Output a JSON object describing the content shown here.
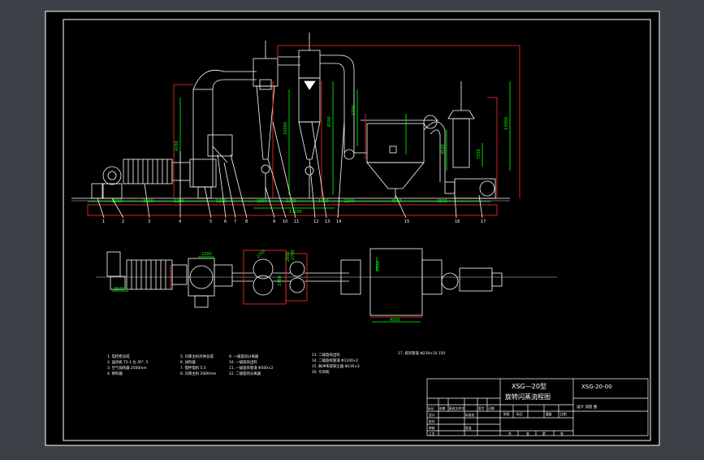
{
  "colors": {
    "outer_bg": "#3c4047",
    "sheet": "#000000",
    "line": "#ffffff",
    "dim": "#00ff00",
    "pipe": "#ff3030",
    "accent": "#ffff00",
    "cyan": "#00d8ff"
  },
  "title_block": {
    "drawing_no": "XSG-20-00",
    "title_line1": "XSG—20型",
    "title_line2": "旋转闪蒸流程图",
    "design_row": "设计  流程  图",
    "row_labels": [
      "标记",
      "处数",
      "更改文件号",
      "签字",
      "日期"
    ],
    "left_labels": [
      "设计",
      "校对",
      "审核",
      "工艺"
    ],
    "mid_labels": [
      "标准化",
      "批准"
    ],
    "stage_labels": [
      "阶段",
      "标记",
      "重量",
      "比例"
    ],
    "bottom_labels": [
      "共",
      "张",
      "第",
      "张"
    ]
  },
  "parts_list": {
    "col1": [
      "1.  电控柜总成",
      "2.  送风机 T2-1 左  45°, 5",
      "3.  空气加热器  2500mm",
      "4.  供料器"
    ],
    "col2": [
      "5.  闪蒸主机壳体总成",
      "6.  加料器",
      "7.  搅拌电机 5.5",
      "8.  闪蒸主机 2000mm"
    ],
    "col3": [
      "9.  一级旋风分离器",
      "10.  一级旋风出料",
      "11.  一级旋风管道 Φ500×2",
      "12.  二级旋风分离器"
    ],
    "col4": [
      "13.  二级旋风出料",
      "14.  二级旋风管道 Φ1100×2",
      "15.  脉冲布袋除尘器 Φ216×2",
      "16.  引风机"
    ],
    "col5": [
      "17.  排风管道 Φ219×10  150"
    ]
  },
  "elevation": {
    "dims": [
      "2500",
      "3300",
      "1200",
      "1200",
      "1800",
      "1200",
      "1400",
      "2200",
      "4500",
      "3200"
    ],
    "total_dim": "13200",
    "vert_dims": [
      "4200",
      "10000",
      "8200",
      "3700",
      "13000",
      "4500",
      "7250"
    ],
    "callouts": [
      "1",
      "2",
      "3",
      "4",
      "5",
      "6",
      "7",
      "8",
      "9",
      "10",
      "11",
      "12",
      "13",
      "14",
      "15",
      "16",
      "17"
    ]
  },
  "plan": {
    "dims": [
      "2500",
      "2200",
      "2700",
      "2800",
      "2700",
      "2700",
      "2500",
      "4500"
    ]
  }
}
